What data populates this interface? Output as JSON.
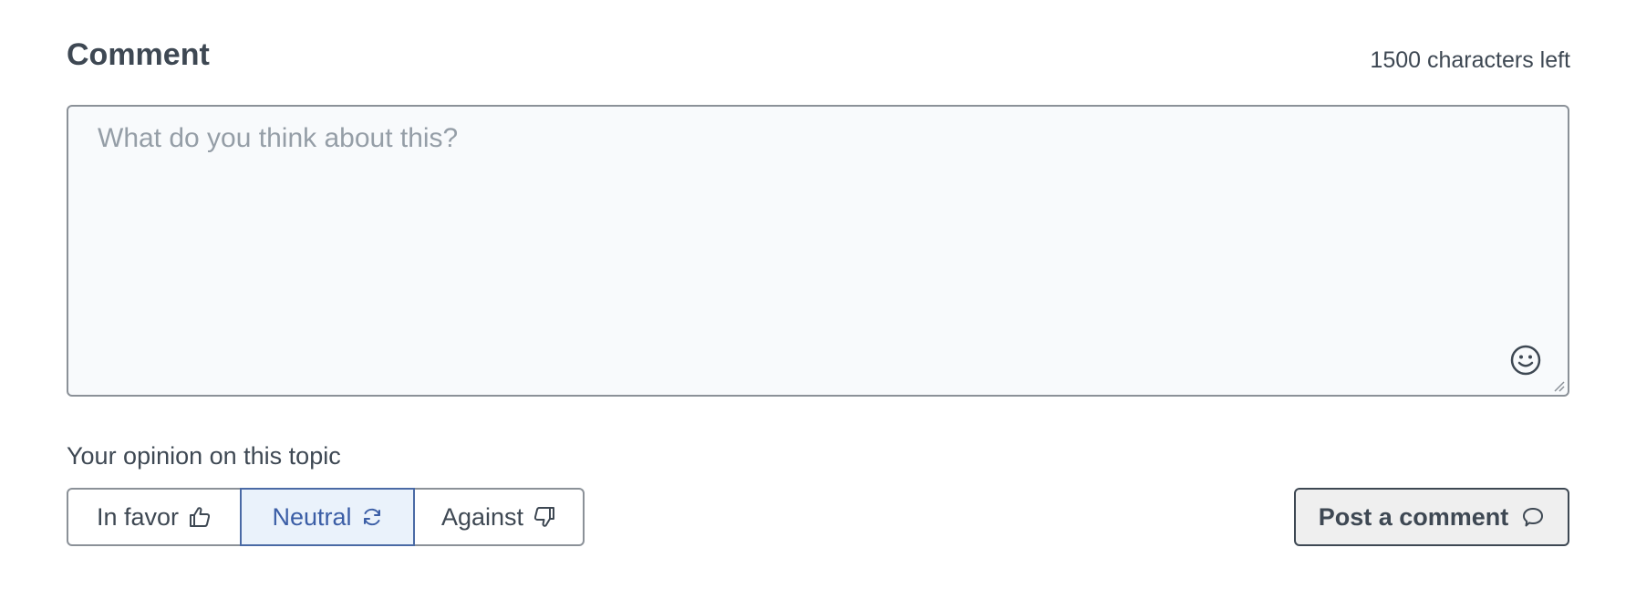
{
  "comment_form": {
    "title": "Comment",
    "characters_left": "1500 characters left",
    "textarea": {
      "placeholder": "What do you think about this?",
      "value": ""
    },
    "emoji_icon": "smiley-face-icon",
    "opinion": {
      "label": "Your opinion on this topic",
      "options": [
        {
          "label": "In favor",
          "icon": "thumbs-up-icon",
          "selected": false
        },
        {
          "label": "Neutral",
          "icon": "refresh-circle-icon",
          "selected": true
        },
        {
          "label": "Against",
          "icon": "thumbs-down-icon",
          "selected": false
        }
      ]
    },
    "submit": {
      "label": "Post a comment",
      "icon": "speech-bubble-icon"
    }
  },
  "colors": {
    "text": "#3e4853",
    "border": "#8b9198",
    "textarea_bg": "#f8fafc",
    "placeholder": "#959ea7",
    "active_bg": "#eaf2fb",
    "active_border": "#4a6aa5",
    "active_text": "#3b5ea6",
    "button_bg": "#efefef"
  }
}
